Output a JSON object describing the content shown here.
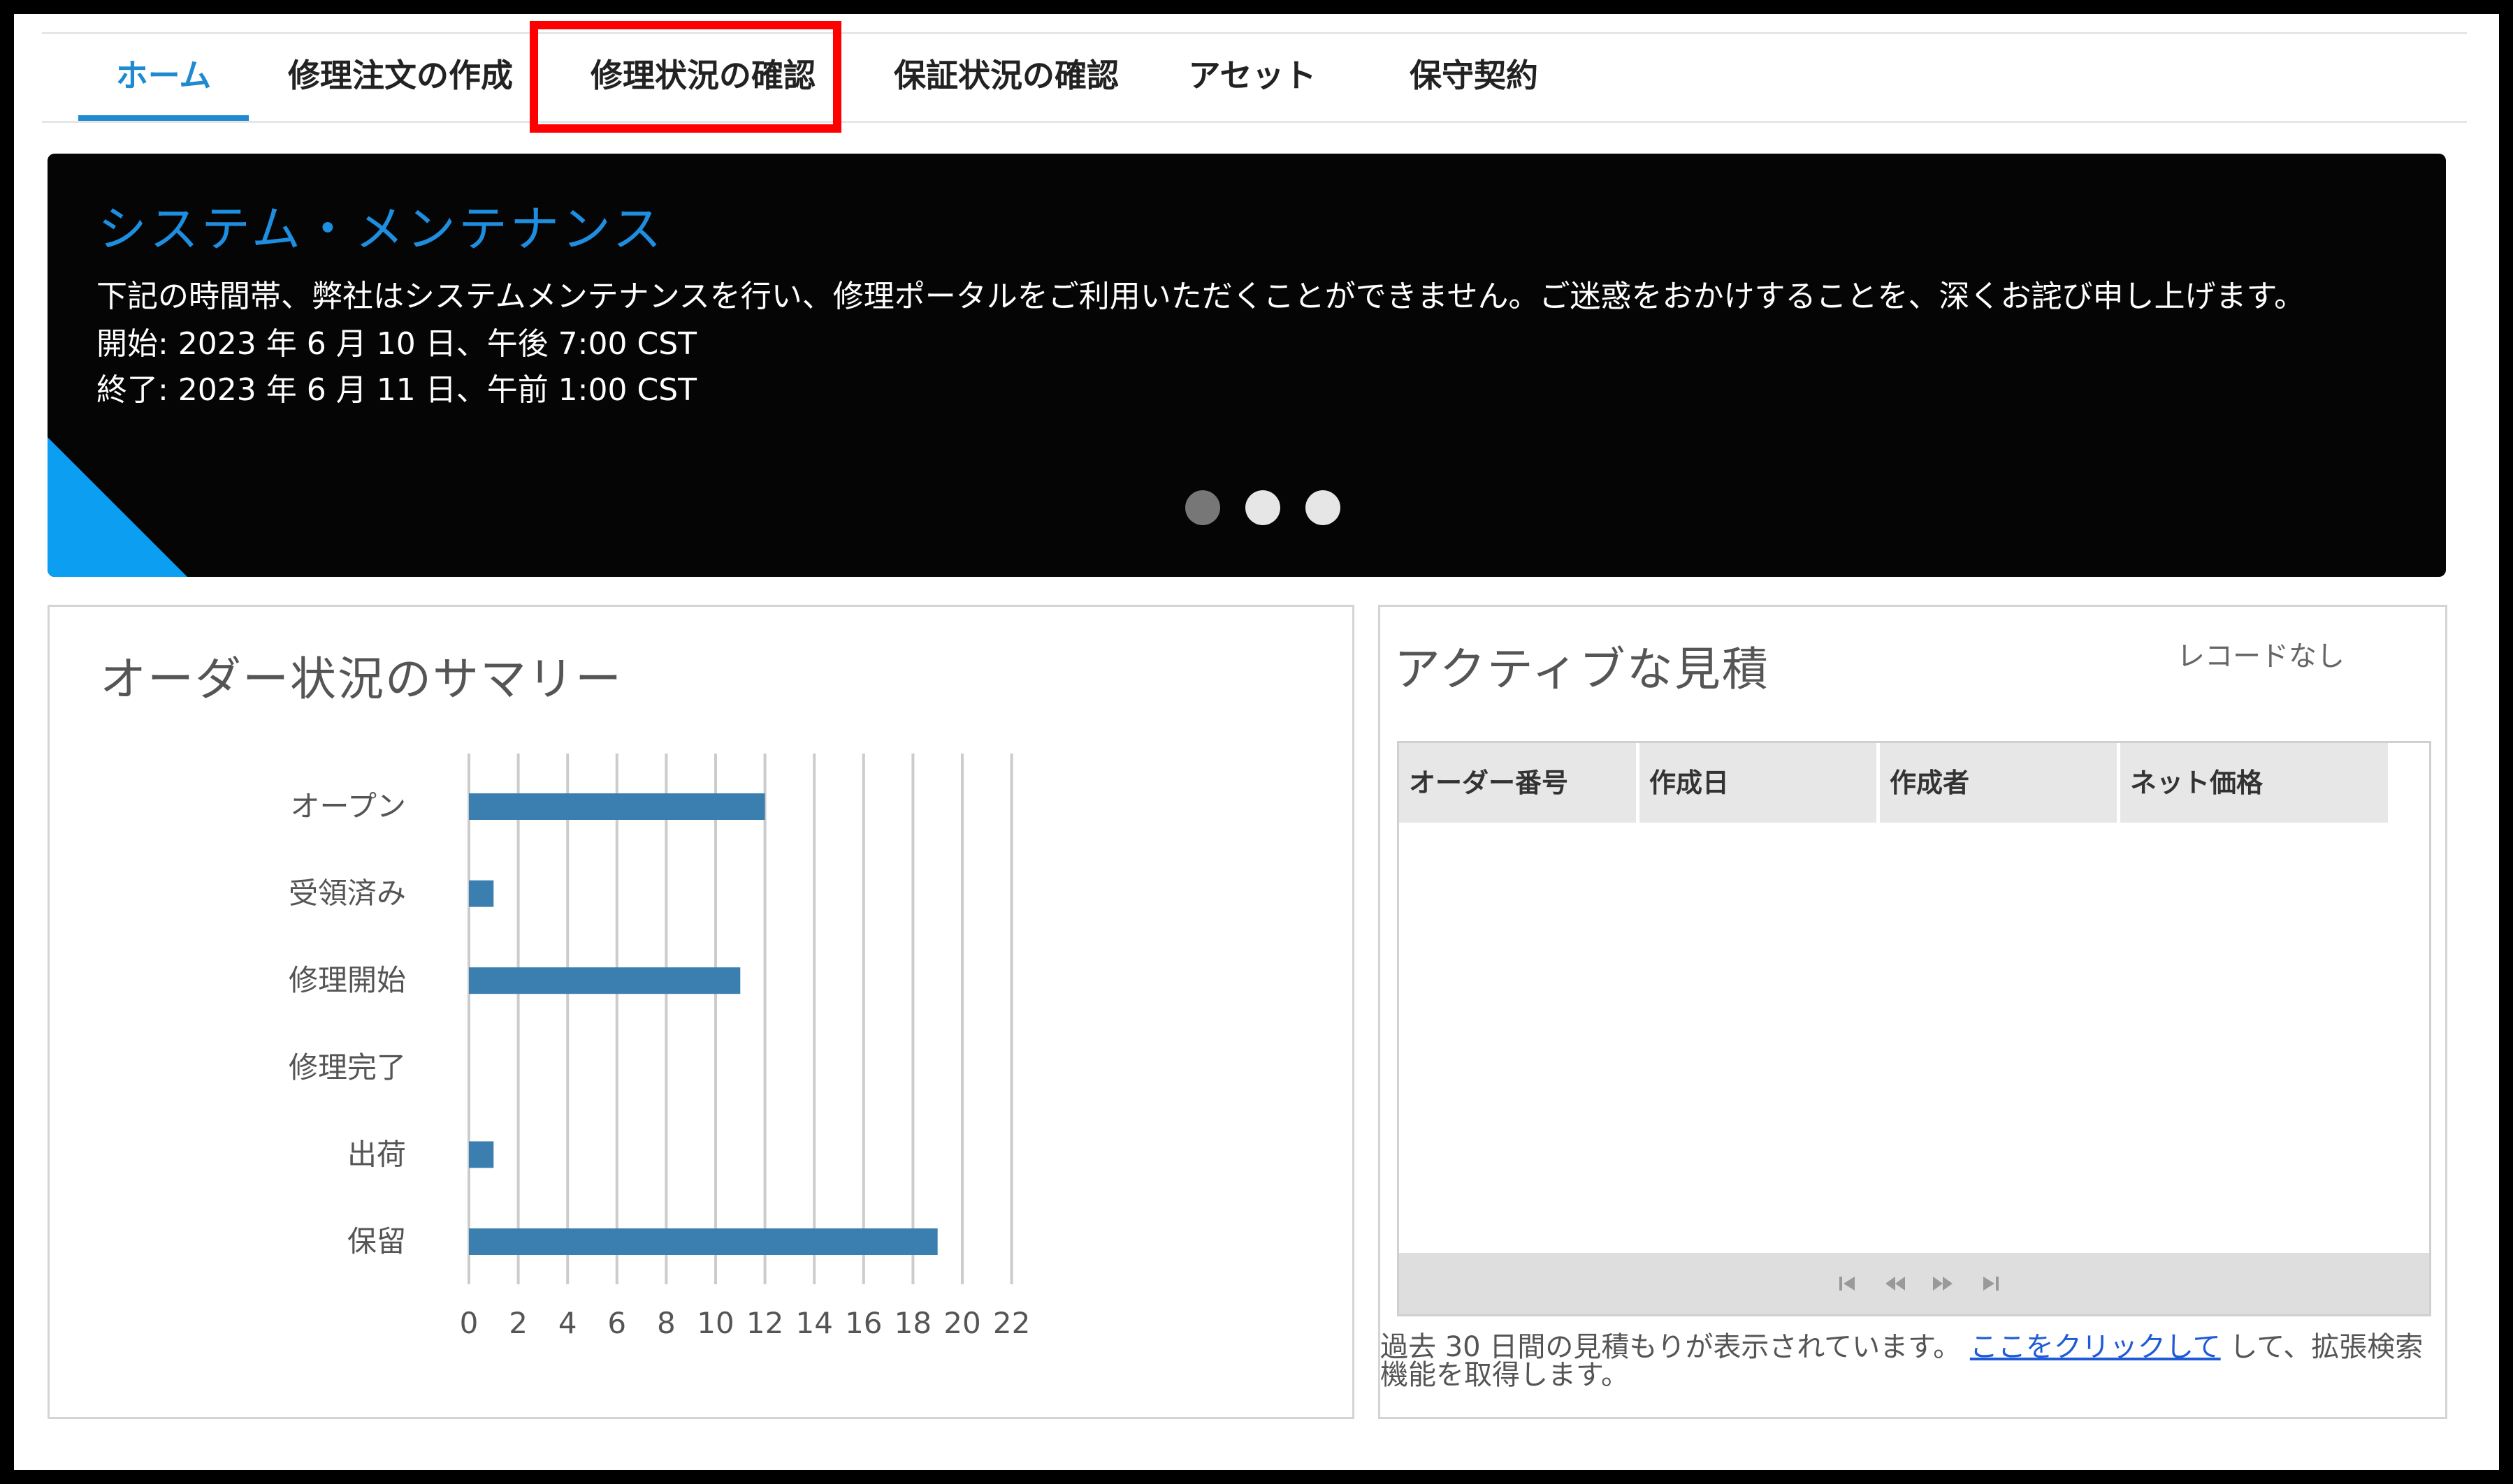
{
  "nav": {
    "tabs": [
      {
        "label": "ホーム",
        "active": true
      },
      {
        "label": "修理注文の作成"
      },
      {
        "label": "修理状況の確認",
        "highlighted": true
      },
      {
        "label": "保証状況の確認"
      },
      {
        "label": "アセット"
      },
      {
        "label": "保守契約"
      }
    ]
  },
  "banner": {
    "title": "システム・メンテナンス",
    "message": "下記の時間帯、弊社はシステムメンテナンスを行い、修理ポータルをご利用いただくことができません。ご迷惑をおかけすることを、深くお詫び申し上げます。",
    "start": "開始: 2023 年 6 月 10 日、午後 7:00 CST",
    "end": "終了: 2023 年 6 月 11 日、午前 1:00 CST",
    "slides": 3,
    "active_slide": 1
  },
  "summary": {
    "title": "オーダー状況のサマリー"
  },
  "chart_data": {
    "type": "bar",
    "orientation": "horizontal",
    "categories": [
      "オープン",
      "受領済み",
      "修理開始",
      "修理完了",
      "出荷",
      "保留"
    ],
    "values": [
      12,
      1,
      11,
      0,
      1,
      19
    ],
    "xlim": [
      0,
      22
    ],
    "xticks": [
      0,
      2,
      4,
      6,
      8,
      10,
      12,
      14,
      16,
      18,
      20,
      22
    ],
    "grid": true,
    "bar_color": "#3a7fb0"
  },
  "quotes": {
    "title": "アクティブな見積",
    "no_records": "レコードなし",
    "columns": [
      "オーダー番号",
      "作成日",
      "作成者",
      "ネット価格"
    ],
    "rows": [],
    "footer_text": "過去 30 日間の見積もりが表示されています。",
    "footer_link": "ここをクリックして",
    "footer_suffix": "して、拡張検索機能を取得します。"
  },
  "colors": {
    "accent": "#1f8ad0",
    "highlight": "#ff0000",
    "banner_bg": "#050505",
    "banner_corner": "#0c9ef0"
  }
}
